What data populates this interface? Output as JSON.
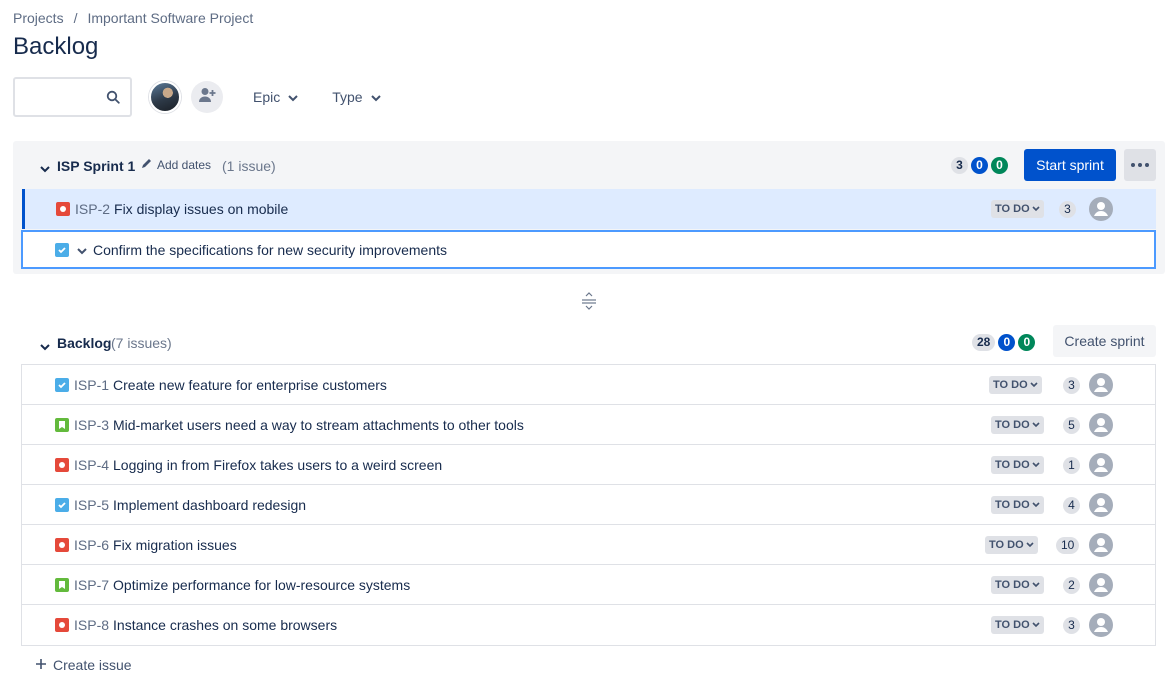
{
  "breadcrumb": {
    "project_root": "Projects",
    "separator": "/",
    "project_name": "Important Software Project"
  },
  "page_title": "Backlog",
  "toolbar": {
    "search_value": "",
    "search_placeholder": "",
    "filter_epic": "Epic",
    "filter_type": "Type"
  },
  "sprint": {
    "name": "ISP Sprint 1",
    "add_dates_label": "Add dates",
    "issue_count": "(1 issue)",
    "counts": {
      "todo": "3",
      "in_progress": "0",
      "done": "0"
    },
    "start_label": "Start sprint",
    "issues": [
      {
        "type": "bug",
        "key": "ISP-2",
        "summary": "Fix display issues on mobile",
        "status": "TO DO",
        "points": "3"
      }
    ],
    "create_row_value": "Confirm the specifications for new security improvements"
  },
  "backlog": {
    "name": "Backlog",
    "issue_count": "(7 issues)",
    "counts": {
      "todo": "28",
      "in_progress": "0",
      "done": "0"
    },
    "create_sprint_label": "Create sprint",
    "issues": [
      {
        "type": "task",
        "key": "ISP-1",
        "summary": "Create new feature for enterprise customers",
        "status": "TO DO",
        "points": "3"
      },
      {
        "type": "story",
        "key": "ISP-3",
        "summary": "Mid-market users need a way to stream attachments to other tools",
        "status": "TO DO",
        "points": "5"
      },
      {
        "type": "bug",
        "key": "ISP-4",
        "summary": "Logging in from Firefox takes users to a weird screen",
        "status": "TO DO",
        "points": "1"
      },
      {
        "type": "task",
        "key": "ISP-5",
        "summary": "Implement dashboard redesign",
        "status": "TO DO",
        "points": "4"
      },
      {
        "type": "bug",
        "key": "ISP-6",
        "summary": "Fix migration issues",
        "status": "TO DO",
        "points": "10"
      },
      {
        "type": "story",
        "key": "ISP-7",
        "summary": "Optimize performance for low-resource systems",
        "status": "TO DO",
        "points": "2"
      },
      {
        "type": "bug",
        "key": "ISP-8",
        "summary": "Instance crashes on some browsers",
        "status": "TO DO",
        "points": "3"
      }
    ],
    "create_issue_label": "Create issue"
  },
  "colors": {
    "primary": "#0052cc",
    "bug": "#e5493a",
    "task": "#4bade8",
    "story": "#63ba3c",
    "done": "#00875a"
  }
}
